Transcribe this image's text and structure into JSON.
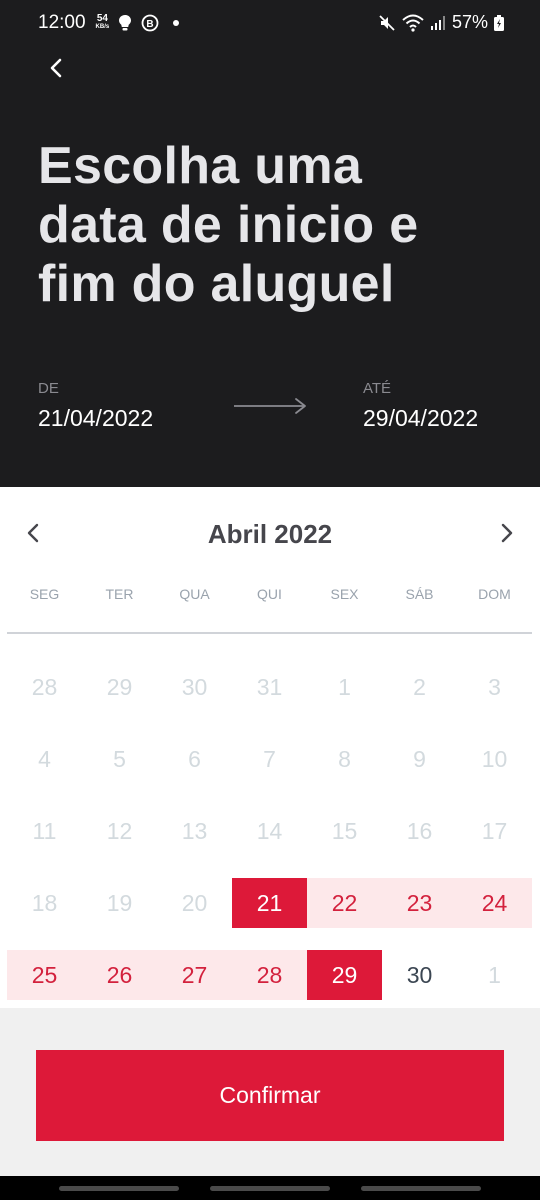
{
  "status_bar": {
    "time": "12:00",
    "net_speed": "54",
    "net_unit": "KB/s",
    "battery": "57%",
    "icons": [
      "lightbulb-icon",
      "b-circle-icon",
      "dot-icon",
      "mute-icon",
      "wifi-icon",
      "signal-icon",
      "battery-icon"
    ]
  },
  "header": {
    "back_icon": "chevron-left-icon",
    "title": "Escolha uma data de inicio e fim do aluguel",
    "from_label": "DE",
    "from_value": "21/04/2022",
    "to_label": "ATÉ",
    "to_value": "29/04/2022",
    "arrow_icon": "arrow-right-icon"
  },
  "calendar": {
    "month_title": "Abril 2022",
    "prev_icon": "chevron-left-icon",
    "next_icon": "chevron-right-icon",
    "weekdays": [
      "SEG",
      "TER",
      "QUA",
      "QUI",
      "SEX",
      "SÁB",
      "DOM"
    ],
    "days": [
      {
        "label": "28",
        "state": "muted"
      },
      {
        "label": "29",
        "state": "muted"
      },
      {
        "label": "30",
        "state": "muted"
      },
      {
        "label": "31",
        "state": "muted"
      },
      {
        "label": "1",
        "state": "muted"
      },
      {
        "label": "2",
        "state": "muted"
      },
      {
        "label": "3",
        "state": "muted"
      },
      {
        "label": "4",
        "state": "muted"
      },
      {
        "label": "5",
        "state": "muted"
      },
      {
        "label": "6",
        "state": "muted"
      },
      {
        "label": "7",
        "state": "muted"
      },
      {
        "label": "8",
        "state": "muted"
      },
      {
        "label": "9",
        "state": "muted"
      },
      {
        "label": "10",
        "state": "muted"
      },
      {
        "label": "11",
        "state": "muted"
      },
      {
        "label": "12",
        "state": "muted"
      },
      {
        "label": "13",
        "state": "muted"
      },
      {
        "label": "14",
        "state": "muted"
      },
      {
        "label": "15",
        "state": "muted"
      },
      {
        "label": "16",
        "state": "muted"
      },
      {
        "label": "17",
        "state": "muted"
      },
      {
        "label": "18",
        "state": "muted"
      },
      {
        "label": "19",
        "state": "muted"
      },
      {
        "label": "20",
        "state": "muted"
      },
      {
        "label": "21",
        "state": "selected"
      },
      {
        "label": "22",
        "state": "in-range"
      },
      {
        "label": "23",
        "state": "in-range"
      },
      {
        "label": "24",
        "state": "in-range"
      },
      {
        "label": "25",
        "state": "in-range"
      },
      {
        "label": "26",
        "state": "in-range"
      },
      {
        "label": "27",
        "state": "in-range"
      },
      {
        "label": "28",
        "state": "in-range"
      },
      {
        "label": "29",
        "state": "selected"
      },
      {
        "label": "30",
        "state": "normal"
      },
      {
        "label": "1",
        "state": "muted"
      }
    ]
  },
  "footer": {
    "confirm_label": "Confirmar"
  },
  "colors": {
    "header_bg": "#1c1c1e",
    "accent": "#dd1939",
    "range_bg": "#fde8ea",
    "range_text": "#d3213d",
    "footer_bg": "#f0f0f0"
  }
}
